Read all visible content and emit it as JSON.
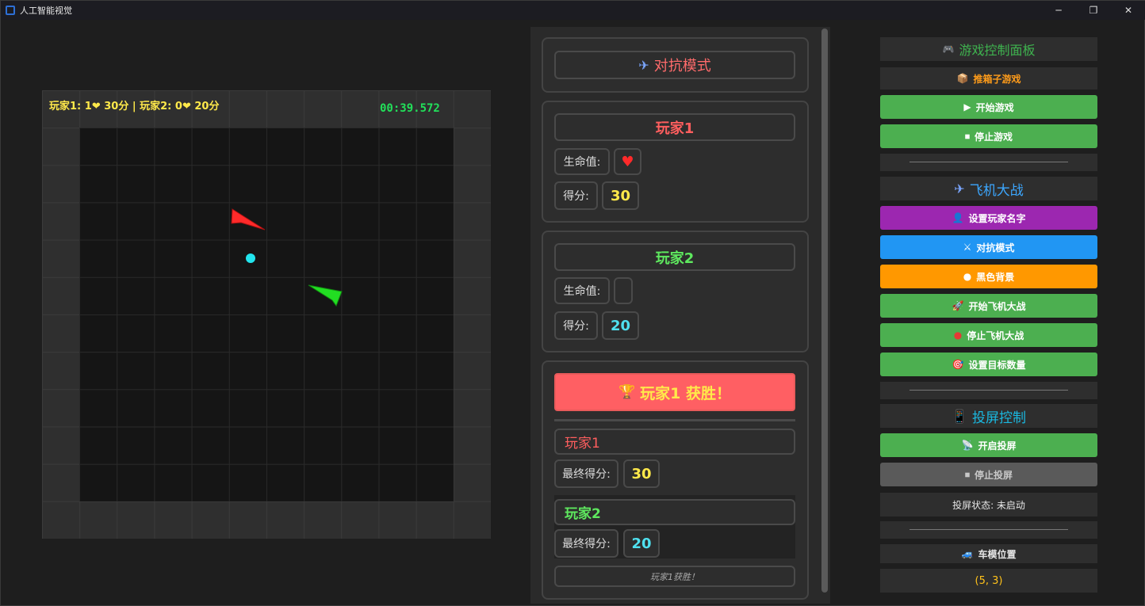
{
  "window": {
    "title": "人工智能视觉",
    "minimize": "─",
    "restore": "❐",
    "close": "✕"
  },
  "game": {
    "score_text": "玩家1: 1❤ 30分 | 玩家2: 0❤ 20分",
    "timer": "00:39.572",
    "player1_color": "#ff2a2a",
    "player2_color": "#22dd22",
    "ball_color": "#22e5ee"
  },
  "battle": {
    "mode_label": "对抗模式",
    "player1": {
      "name": "玩家1",
      "hp_label": "生命值:",
      "hp_icon": "♥",
      "score_label": "得分:",
      "score": "30"
    },
    "player2": {
      "name": "玩家2",
      "hp_label": "生命值:",
      "hp_icon": "",
      "score_label": "得分:",
      "score": "20"
    },
    "result": {
      "winner_text": "玩家1 获胜！",
      "p1_name": "玩家1",
      "p1_final_label": "最终得分:",
      "p1_final": "30",
      "p2_name": "玩家2",
      "p2_final_label": "最终得分:",
      "p2_final": "20",
      "note": "玩家1获胜！"
    }
  },
  "controls": {
    "header": "游戏控制面板",
    "sokoban_label": "推箱子游戏",
    "start_game": "开始游戏",
    "stop_game": "停止游戏",
    "plane_header": "飞机大战",
    "set_names": "设置玩家名字",
    "versus_mode": "对抗模式",
    "black_bg": "黑色背景",
    "start_plane": "开始飞机大战",
    "stop_plane": "停止飞机大战",
    "set_target": "设置目标数量",
    "cast_header": "投屏控制",
    "start_cast": "开启投屏",
    "stop_cast": "停止投屏",
    "cast_status": "投屏状态: 未启动",
    "car_label": "车模位置",
    "car_pos": "(5, 3)",
    "colors": {
      "green": "#4caf50",
      "purple": "#9c27b0",
      "blue": "#2196f3",
      "orange": "#ff9800",
      "gray": "#5a5a5a"
    }
  }
}
